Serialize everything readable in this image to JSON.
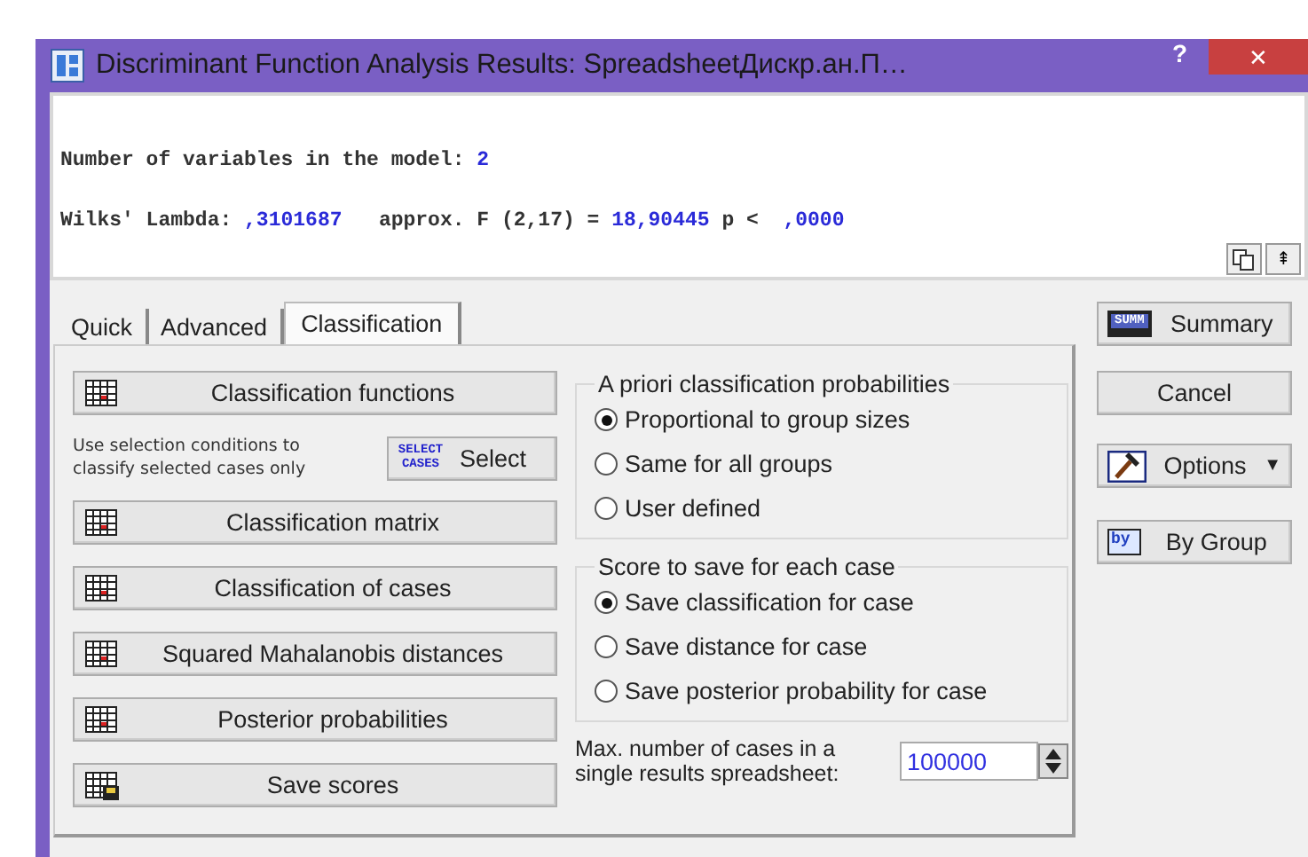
{
  "window": {
    "title": "Discriminant Function Analysis Results: SpreadsheetДискр.ан.П…",
    "help": "?",
    "close": "✕"
  },
  "output": [
    [
      {
        "kind": "label",
        "text": "Number of variables in the model: "
      },
      {
        "kind": "value",
        "text": "2"
      }
    ],
    [
      {
        "kind": "label",
        "text": "Wilks' Lambda: "
      },
      {
        "kind": "value",
        "text": ",3101687"
      },
      {
        "kind": "label",
        "text": "   approx. F (2,17) = "
      },
      {
        "kind": "value",
        "text": "18,90445"
      },
      {
        "kind": "label",
        "text": " p < "
      },
      {
        "kind": "value",
        "text": " ,0000"
      }
    ]
  ],
  "output_buttons": [
    "⇞"
  ],
  "tabs": [
    {
      "label": "Quick",
      "selected": false
    },
    {
      "label": "Advanced",
      "selected": false
    },
    {
      "label": "Classification",
      "selected": true
    }
  ],
  "left_buttons": [
    {
      "kind": "grid",
      "label": "Classification functions"
    },
    {
      "kind": "select",
      "note": "Use selection conditions to classify selected cases only",
      "icon_text": "SELECT CASES",
      "label": "Select"
    },
    {
      "kind": "grid",
      "label": "Classification matrix"
    },
    {
      "kind": "grid",
      "label": "Classification of cases"
    },
    {
      "kind": "grid",
      "label": "Squared Mahalanobis distances"
    },
    {
      "kind": "grid",
      "label": "Posterior probabilities"
    },
    {
      "kind": "save",
      "label": "Save scores"
    }
  ],
  "groups": [
    {
      "title": "A priori classification probabilities",
      "options": [
        {
          "label": "Proportional to group sizes",
          "selected": true
        },
        {
          "label": "Same for all groups",
          "selected": false
        },
        {
          "label": "User defined",
          "selected": false
        }
      ]
    },
    {
      "title": "Score to save for each case",
      "options": [
        {
          "label": "Save classification for case",
          "selected": true
        },
        {
          "label": "Save distance for case",
          "selected": false
        },
        {
          "label": "Save posterior probability for case",
          "selected": false
        }
      ]
    }
  ],
  "max_cases": {
    "label": "Max. number of cases in a single results spreadsheet:",
    "value": "100000"
  },
  "side_buttons": [
    {
      "kind": "summary",
      "label": "Summary",
      "icon_text": "SUMM"
    },
    {
      "kind": "plain",
      "label": "Cancel"
    },
    {
      "kind": "options",
      "label": "Options",
      "caret": "▼"
    },
    {
      "kind": "bygroup",
      "label": "By Group",
      "icon_text": "by"
    }
  ]
}
